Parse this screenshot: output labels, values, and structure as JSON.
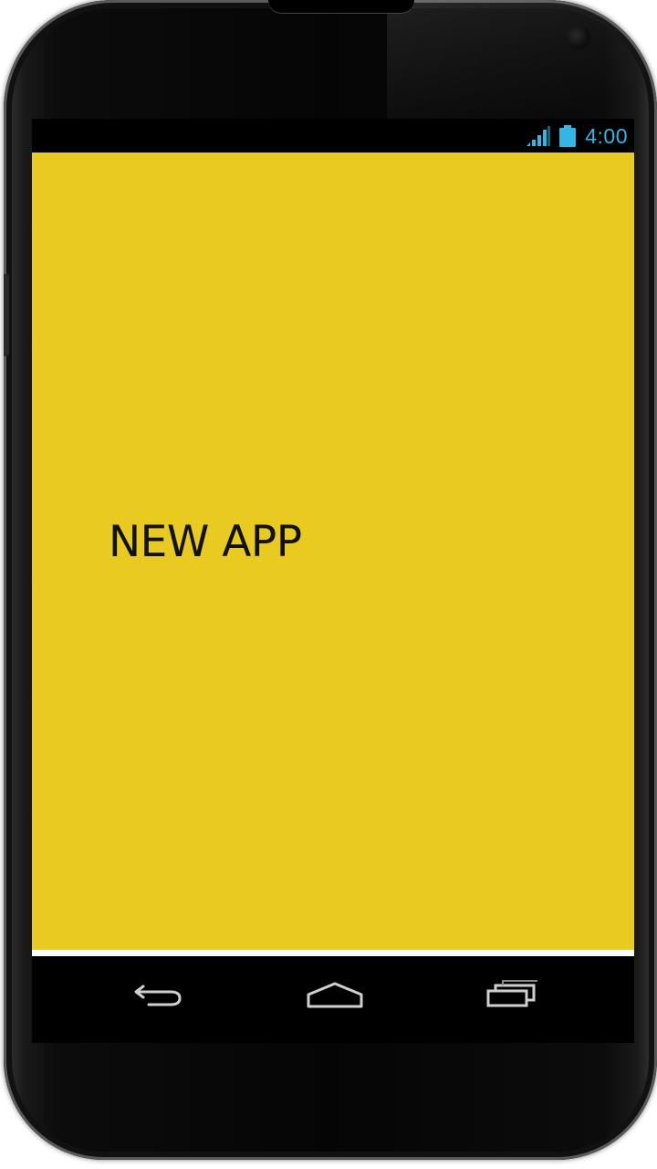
{
  "status_bar": {
    "time": "4:00",
    "signal_icon": "signal-icon",
    "battery_icon": "battery-icon",
    "accent_color": "#33b5e5"
  },
  "app": {
    "title": "NEW APP",
    "background_color": "#e9ca20",
    "text_color": "#111111"
  },
  "nav_bar": {
    "back_icon": "back-icon",
    "home_icon": "home-icon",
    "recents_icon": "recents-icon"
  }
}
